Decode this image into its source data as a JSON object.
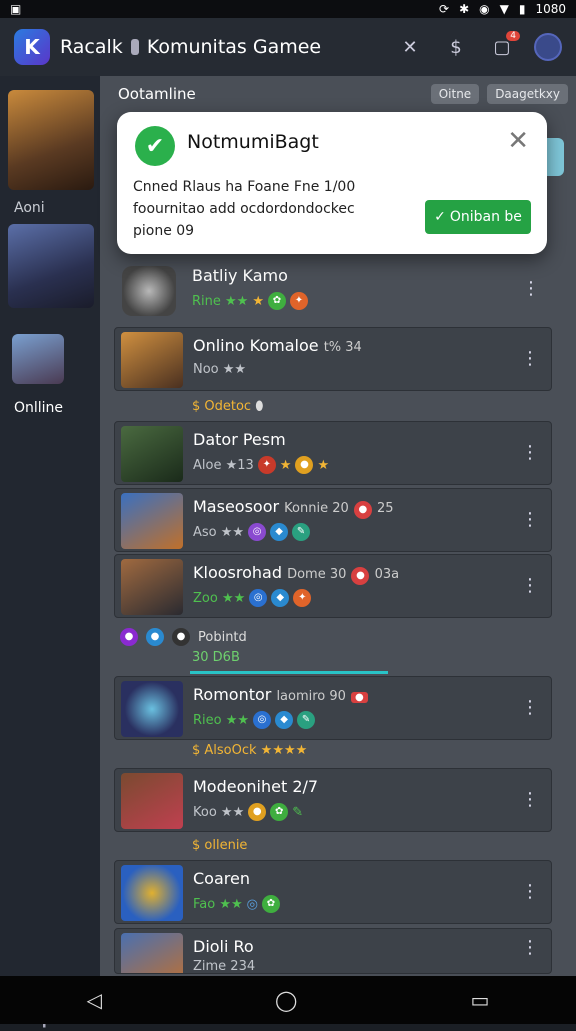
{
  "status": {
    "time": "1080"
  },
  "appbar": {
    "title_a": "Racalk",
    "title_b": "Komunitas Gamee",
    "notif_count": "4"
  },
  "sidebar": {
    "label_top": "Aoni",
    "label_online": "Onlline"
  },
  "filters": {
    "label": "Ootamline",
    "chip1": "Oitne",
    "chip2": "Daagetkxy"
  },
  "notification": {
    "title": "NotmumiBagt",
    "body": "Cnned Rlaus ha Foane Fne 1/00 foournitao add ocdordondockec pione 09",
    "action": "Oniban be"
  },
  "games": [
    {
      "name": "Batliy Kamo",
      "meta": "Rine ★★"
    },
    {
      "name": "Onlino Komaloe",
      "extra": "t% 34",
      "meta": "Noo ★★"
    },
    {
      "name": "Dator Pesm",
      "meta": "Aloe ★13"
    },
    {
      "name": "Maseosoor",
      "extra": "Konnie 20",
      "badge": "25",
      "meta": "Aso ★★"
    },
    {
      "name": "Kloosrohad",
      "extra": "Dome 30",
      "badge": "03a",
      "meta": "Zoo ★★"
    },
    {
      "name": "Romontor",
      "extra": "laomiro 90",
      "meta": "Rieo ★★"
    },
    {
      "name": "Modeonihet 2/7",
      "meta": "Koo ★★"
    },
    {
      "name": "Coaren",
      "meta": "Fao ★★"
    },
    {
      "name": "Dioli Ro",
      "meta": "Zime 234"
    }
  ],
  "subrows": {
    "row1": "$ Odetoc",
    "row2a": "Pobintd",
    "row2b": "30 D6B",
    "row3": "$ AlsoOck ★★★★",
    "row4": "$ ollenie"
  },
  "colors": {
    "accent_green": "#2bb04c",
    "star_gold": "#f2b535",
    "badge_red": "#e0453a"
  }
}
